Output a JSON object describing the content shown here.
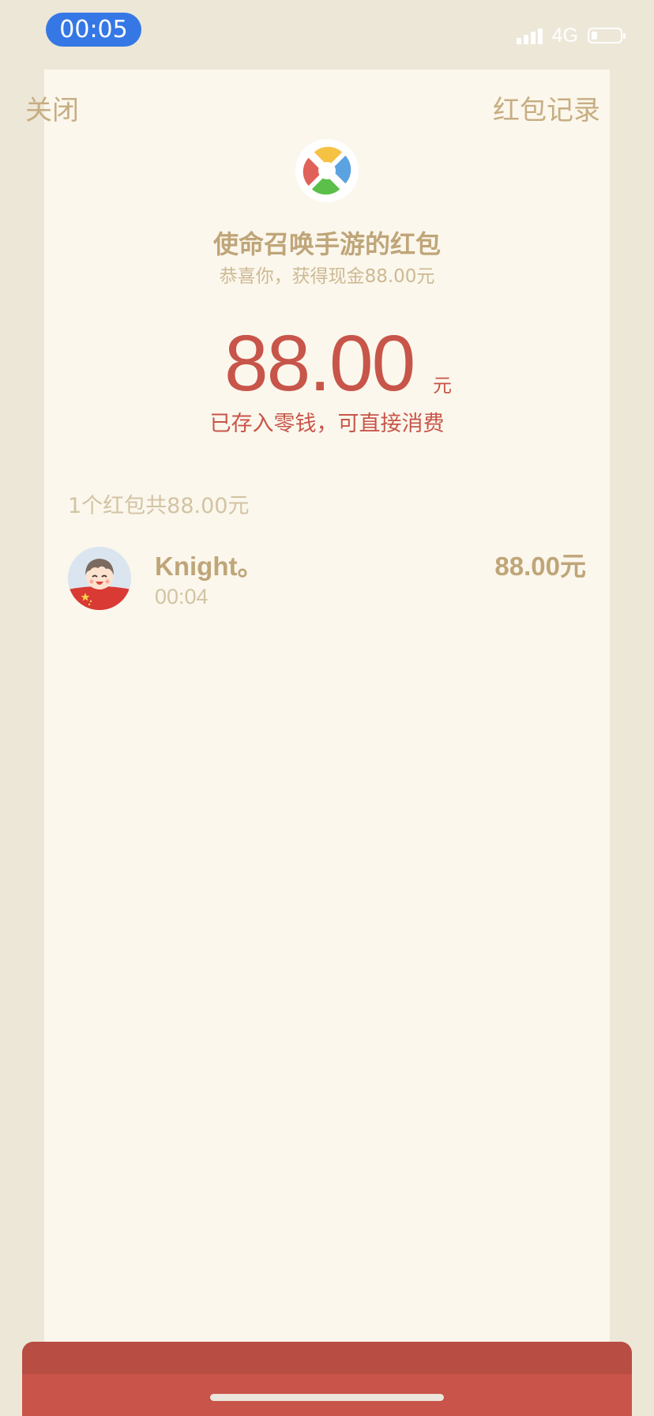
{
  "status_bar": {
    "time": "00:05",
    "network": "4G"
  },
  "nav": {
    "close_label": "关闭",
    "records_label": "红包记录"
  },
  "envelope": {
    "title": "使命召唤手游的红包",
    "subtitle": "恭喜你，获得现金88.00元",
    "amount": "88.00",
    "amount_unit": "元",
    "stored_note": "已存入零钱，可直接消费"
  },
  "summary": "1个红包共88.00元",
  "records": [
    {
      "name": "Knight。",
      "time": "00:04",
      "amount": "88.00元"
    }
  ],
  "colors": {
    "background": "#ede7d8",
    "sheet": "#fbf7ec",
    "gold_text": "#bfa579",
    "light_gold_text": "#d3c3a4",
    "red_accent": "#c8554a",
    "time_pill": "#3578e5"
  },
  "icons": {
    "app_logo": "pinwheel-logo-icon",
    "avatar": "user-avatar",
    "battery": "battery-icon",
    "signal": "signal-icon"
  }
}
